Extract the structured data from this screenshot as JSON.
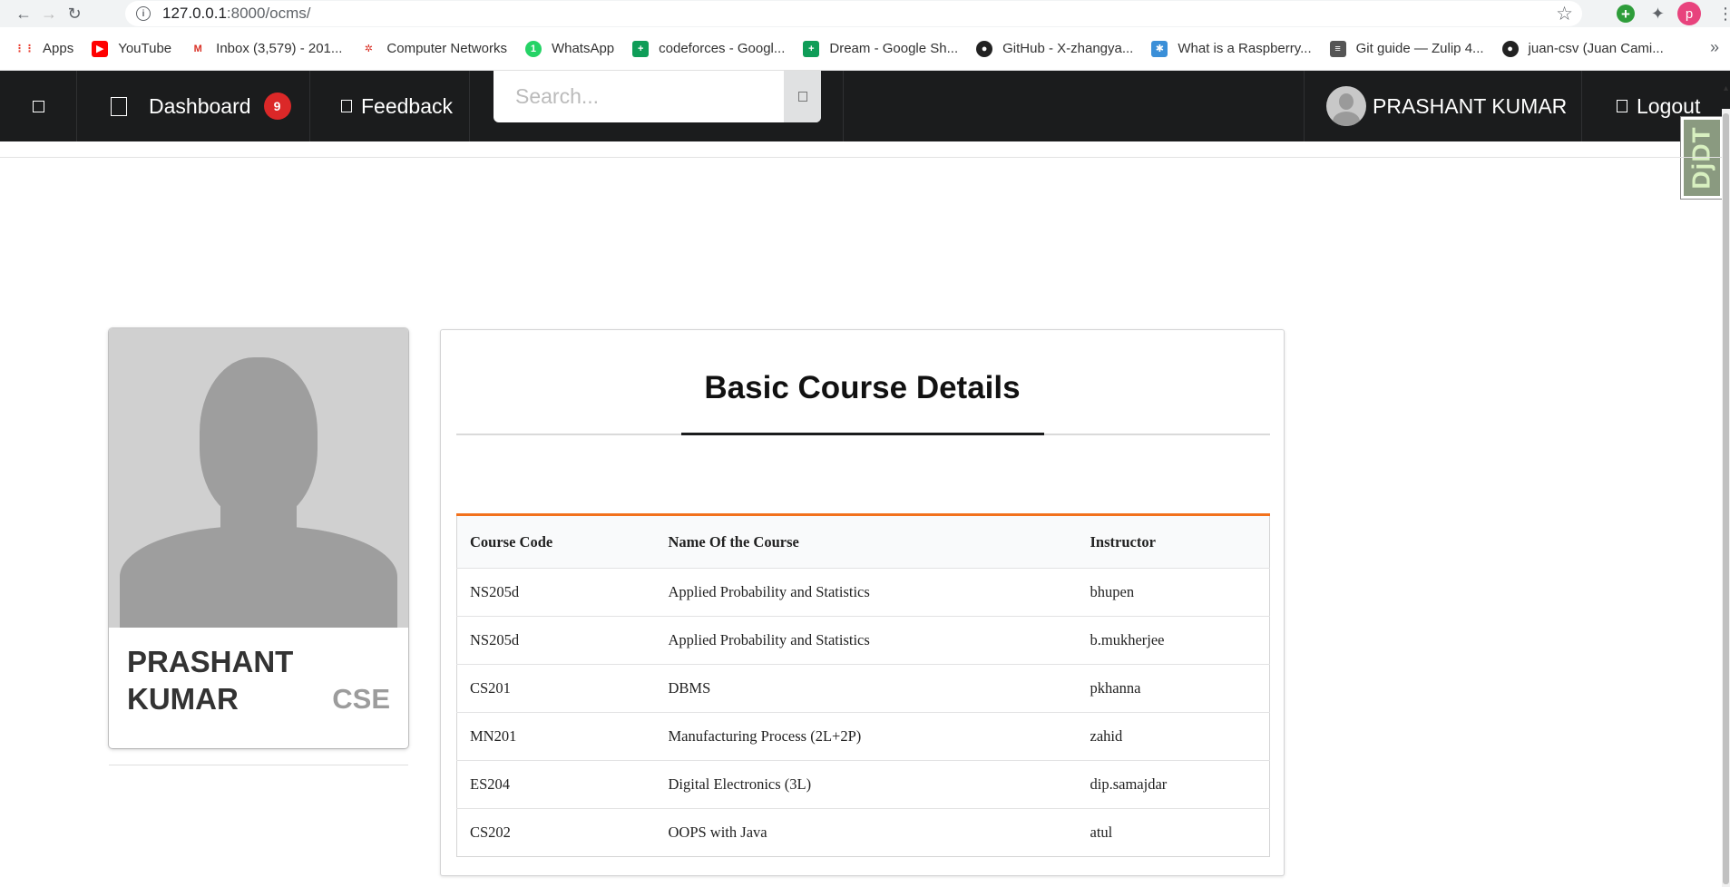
{
  "browser": {
    "url_host": "127.0.0.1",
    "url_path": ":8000/ocms/"
  },
  "bookmarks": [
    {
      "label": "Apps",
      "icon": "apps-grid-icon",
      "color": "#ea4335"
    },
    {
      "label": "YouTube",
      "icon": "youtube-icon",
      "color": "#ff0000"
    },
    {
      "label": "Inbox (3,579) - 201...",
      "icon": "gmail-icon",
      "color": "#d93025"
    },
    {
      "label": "Computer Networks",
      "icon": "cn-icon",
      "color": "#d93025"
    },
    {
      "label": "WhatsApp",
      "icon": "whatsapp-icon",
      "color": "#25d366"
    },
    {
      "label": "codeforces - Googl...",
      "icon": "sheets-icon",
      "color": "#0f9d58"
    },
    {
      "label": "Dream - Google Sh...",
      "icon": "sheets-icon",
      "color": "#0f9d58"
    },
    {
      "label": "GitHub - X-zhangya...",
      "icon": "github-icon",
      "color": "#222222"
    },
    {
      "label": "What is a Raspberry...",
      "icon": "raspberry-icon",
      "color": "#3a8fd8"
    },
    {
      "label": "Git guide — Zulip 4...",
      "icon": "zulip-icon",
      "color": "#555555"
    },
    {
      "label": "juan-csv (Juan Cami...",
      "icon": "github-icon",
      "color": "#222222"
    }
  ],
  "nav": {
    "dashboard_label": "Dashboard",
    "dashboard_badge": "9",
    "feedback_label": "Feedback",
    "search_placeholder": "Search...",
    "user_name": "PRASHANT KUMAR",
    "logout_label": "Logout"
  },
  "djdt_label": "DjDT",
  "profile": {
    "name": "PRASHANT KUMAR",
    "dept": "CSE"
  },
  "course_panel": {
    "title": "Basic Course Details",
    "headers": [
      "Course Code",
      "Name Of the Course",
      "Instructor"
    ],
    "rows": [
      {
        "code": "NS205d",
        "name": "Applied Probability and Statistics",
        "instructor": "bhupen"
      },
      {
        "code": "NS205d",
        "name": "Applied Probability and Statistics",
        "instructor": "b.mukherjee"
      },
      {
        "code": "CS201",
        "name": "DBMS",
        "instructor": "pkhanna"
      },
      {
        "code": "MN201",
        "name": "Manufacturing Process (2L+2P)",
        "instructor": "zahid"
      },
      {
        "code": "ES204",
        "name": "Digital Electronics (3L)",
        "instructor": "dip.samajdar"
      },
      {
        "code": "CS202",
        "name": "OOPS with Java",
        "instructor": "atul"
      }
    ]
  },
  "colors": {
    "nav_bg": "#1b1c1d",
    "badge": "#db2828",
    "table_accent": "#f2711c"
  }
}
